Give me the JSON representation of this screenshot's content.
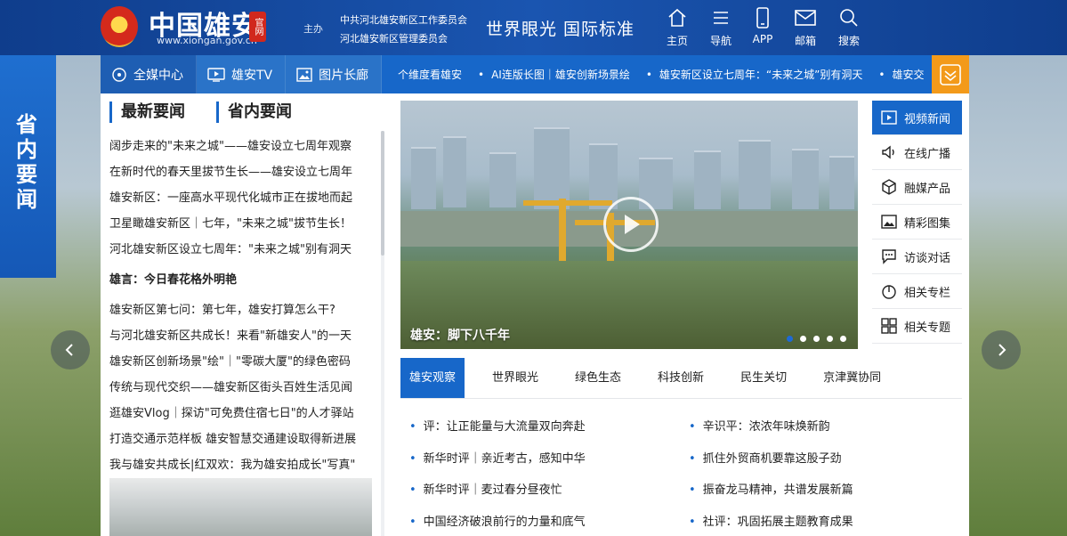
{
  "header": {
    "logo_name": "中国雄安",
    "logo_url": "www.xiongan.gov.cn",
    "seal_text": "官网",
    "host_label": "主办",
    "host_names": [
      "中共河北雄安新区工作委员会",
      "河北雄安新区管理委员会"
    ],
    "slogan": "世界眼光 国际标准",
    "nav": [
      {
        "label": "主页",
        "icon": "home-icon"
      },
      {
        "label": "导航",
        "icon": "menu-icon"
      },
      {
        "label": "APP",
        "icon": "phone-icon"
      },
      {
        "label": "邮箱",
        "icon": "mail-icon"
      },
      {
        "label": "搜索",
        "icon": "search-icon"
      }
    ]
  },
  "subbar": {
    "channels": [
      {
        "label": "全媒中心",
        "icon": "media-center-icon"
      },
      {
        "label": "雄安TV",
        "icon": "tv-icon"
      },
      {
        "label": "图片长廊",
        "icon": "picture-icon"
      }
    ],
    "ticker": [
      "个维度看雄安",
      "AI连版长图｜雄安创新场景绘",
      "雄安新区设立七周年：“未来之城”别有洞天",
      "雄安交"
    ]
  },
  "side_tab": "省内要闻",
  "news": {
    "tabs": [
      "最新要闻",
      "省内要闻"
    ],
    "items": [
      {
        "text": "阔步走来的\"未来之城\"——雄安设立七周年观察",
        "bold": false
      },
      {
        "text": "在新时代的春天里拔节生长——雄安设立七周年",
        "bold": false
      },
      {
        "text": "雄安新区：一座高水平现代化城市正在拔地而起",
        "bold": false
      },
      {
        "text": "卫星瞰雄安新区｜七年，\"未来之城\"拔节生长！",
        "bold": false
      },
      {
        "text": "河北雄安新区设立七周年：\"未来之城\"别有洞天",
        "bold": false
      },
      {
        "text": "雄言：今日春花格外明艳",
        "bold": true
      },
      {
        "text": "雄安新区第七问：第七年，雄安打算怎么干?",
        "bold": false
      },
      {
        "text": "与河北雄安新区共成长！来看\"新雄安人\"的一天",
        "bold": false
      },
      {
        "text": "雄安新区创新场景\"绘\"｜\"零碳大厦\"的绿色密码",
        "bold": false
      },
      {
        "text": "传统与现代交织——雄安新区街头百姓生活见闻",
        "bold": false
      },
      {
        "text": "逛雄安Vlog｜探访\"可免费住宿七日\"的人才驿站",
        "bold": false
      },
      {
        "text": "打造交通示范样板 雄安智慧交通建设取得新进展",
        "bold": false
      },
      {
        "text": "我与雄安共成长|红双欢：我为雄安拍成长\"写真\"",
        "bold": false
      }
    ]
  },
  "video": {
    "caption": "雄安：脚下八千年",
    "dots": 5,
    "active_dot": 0
  },
  "right_menu": [
    {
      "label": "视频新闻",
      "icon": "video-news-icon",
      "active": true
    },
    {
      "label": "在线广播",
      "icon": "broadcast-icon",
      "active": false
    },
    {
      "label": "融媒产品",
      "icon": "cube-icon",
      "active": false
    },
    {
      "label": "精彩图集",
      "icon": "gallery-icon",
      "active": false
    },
    {
      "label": "访谈对话",
      "icon": "chat-icon",
      "active": false
    },
    {
      "label": "相关专栏",
      "icon": "column-icon",
      "active": false
    },
    {
      "label": "相关专题",
      "icon": "topics-icon",
      "active": false
    }
  ],
  "categories": {
    "tabs": [
      "雄安观察",
      "世界眼光",
      "绿色生态",
      "科技创新",
      "民生关切",
      "京津冀协同"
    ],
    "active": 0,
    "left": [
      "评：让正能量与大流量双向奔赴",
      "新华时评｜亲近考古，感知中华",
      "新华时评｜麦过春分昼夜忙",
      "中国经济破浪前行的力量和底气"
    ],
    "right": [
      "辛识平：浓浓年味焕新韵",
      "抓住外贸商机要靠这股子劲",
      "振奋龙马精神，共谱发展新篇",
      "社评：巩固拓展主题教育成果"
    ]
  },
  "colors": {
    "primary": "#1767c9",
    "header": "#0f3d8c",
    "accent": "#f39a1a"
  }
}
